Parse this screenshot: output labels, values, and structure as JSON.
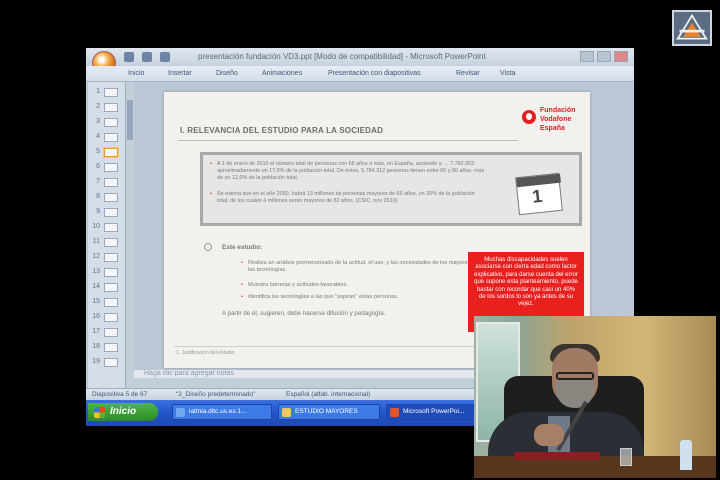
{
  "window": {
    "title": "presentación fundación VD3.ppt [Modo de compatibilidad] - Microsoft PowerPoint"
  },
  "ribbon": {
    "tabs": [
      "Inicio",
      "Insertar",
      "Diseño",
      "Animaciones",
      "Presentación con diapositivas",
      "Revisar",
      "Vista"
    ]
  },
  "thumbnails": {
    "numbers": [
      "1",
      "2",
      "3",
      "4",
      "5",
      "6",
      "7",
      "8",
      "9",
      "10",
      "11",
      "12",
      "13",
      "14",
      "15",
      "16",
      "17",
      "18",
      "19"
    ],
    "selected": "5"
  },
  "slide": {
    "heading": "I.   RELEVANCIA DEL ESTUDIO PARA LA SOCIEDAD",
    "brand": "Fundación Vodafone España",
    "facts": [
      "A 1 de enero de 2010 el número total de personas con 65 años o más, en España, asciende a → 7.782.903 aproximadamente un 17,0% de la población total. De éstos, 5.784.312 personas tienen entre 65 y 80 años, más de un 12,0% de la población total.",
      "Se estima que en el año 2050, habrá 13 millones de personas mayores de 65 años, un 30% de la población total, de los cuales 4 millones serán mayores de 82 años. (CSIC, nov 2010)"
    ],
    "calendar_day": "1",
    "study_label": "Este estudio:",
    "study_items": [
      "Realiza un análisis pormenorizado de la actitud, el uso, y las necesidades de los mayores frente las tecnologías.",
      "Muestra barreras y actitudes favorables.",
      "Identifica las tecnologías a las que \"aspiran\" estas personas."
    ],
    "conclusion": "A partir de él, sugieren, debe hacerse difusión y pedagogía.",
    "footer": "1. Justificación del estudio",
    "red_note": "Muchas discapacidades suelen asociarse con cierta edad como factor explicativo, para darse cuenta del error que supone esta planteamiento, puede bastar con recordar que casi un 40% de los sordos lo son ya antes de su vejez."
  },
  "notes": {
    "text": "Haga clic para agregar notas"
  },
  "status": {
    "slide_position": "Diapositiva 5 de 67",
    "theme": "\"2_Diseño predeterminado\"",
    "language": "Español (alfab. internacional)"
  },
  "taskbar": {
    "start_label": "Inicio",
    "tasks": [
      "lattnia.dltc.us.es:1...",
      "ESTUDIO MAYORES",
      "Microsoft PowerPoi..."
    ]
  }
}
